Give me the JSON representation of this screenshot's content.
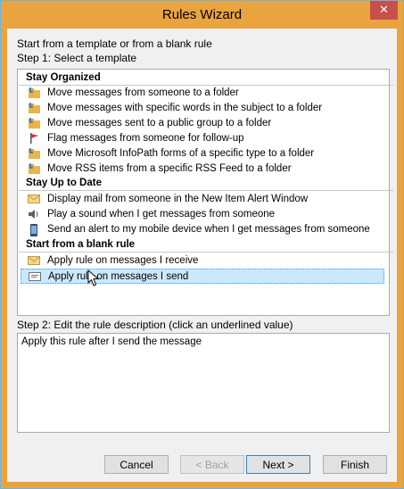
{
  "window": {
    "title": "Rules Wizard",
    "close_glyph": "✕"
  },
  "intro": "Start from a template or from a blank rule",
  "step1": "Step 1: Select a template",
  "groups": [
    {
      "label": "Stay Organized",
      "items": [
        {
          "icon": "folder-arrow-icon",
          "text": "Move messages from someone to a folder"
        },
        {
          "icon": "folder-arrow-icon",
          "text": "Move messages with specific words in the subject to a folder"
        },
        {
          "icon": "folder-arrow-icon",
          "text": "Move messages sent to a public group to a folder"
        },
        {
          "icon": "flag-icon",
          "text": "Flag messages from someone for follow-up"
        },
        {
          "icon": "folder-arrow-icon",
          "text": "Move Microsoft InfoPath forms of a specific type to a folder"
        },
        {
          "icon": "folder-arrow-icon",
          "text": "Move RSS items from a specific RSS Feed to a folder"
        }
      ]
    },
    {
      "label": "Stay Up to Date",
      "items": [
        {
          "icon": "envelope-icon",
          "text": "Display mail from someone in the New Item Alert Window"
        },
        {
          "icon": "speaker-icon",
          "text": "Play a sound when I get messages from someone"
        },
        {
          "icon": "mobile-device-icon",
          "text": "Send an alert to my mobile device when I get messages from someone"
        }
      ]
    },
    {
      "label": "Start from a blank rule",
      "items": [
        {
          "icon": "envelope-icon",
          "text": "Apply rule on messages I receive"
        },
        {
          "icon": "envelope-send-icon",
          "text": "Apply rule on messages I send"
        }
      ]
    }
  ],
  "step2": "Step 2: Edit the rule description (click an underlined value)",
  "description": "Apply this rule after I send the message",
  "buttons": {
    "cancel": "Cancel",
    "back": "< Back",
    "next": "Next >",
    "finish": "Finish"
  },
  "colors": {
    "titlebar": "#e9a43f",
    "selection": "#cce8ff",
    "close": "#c7504b"
  }
}
